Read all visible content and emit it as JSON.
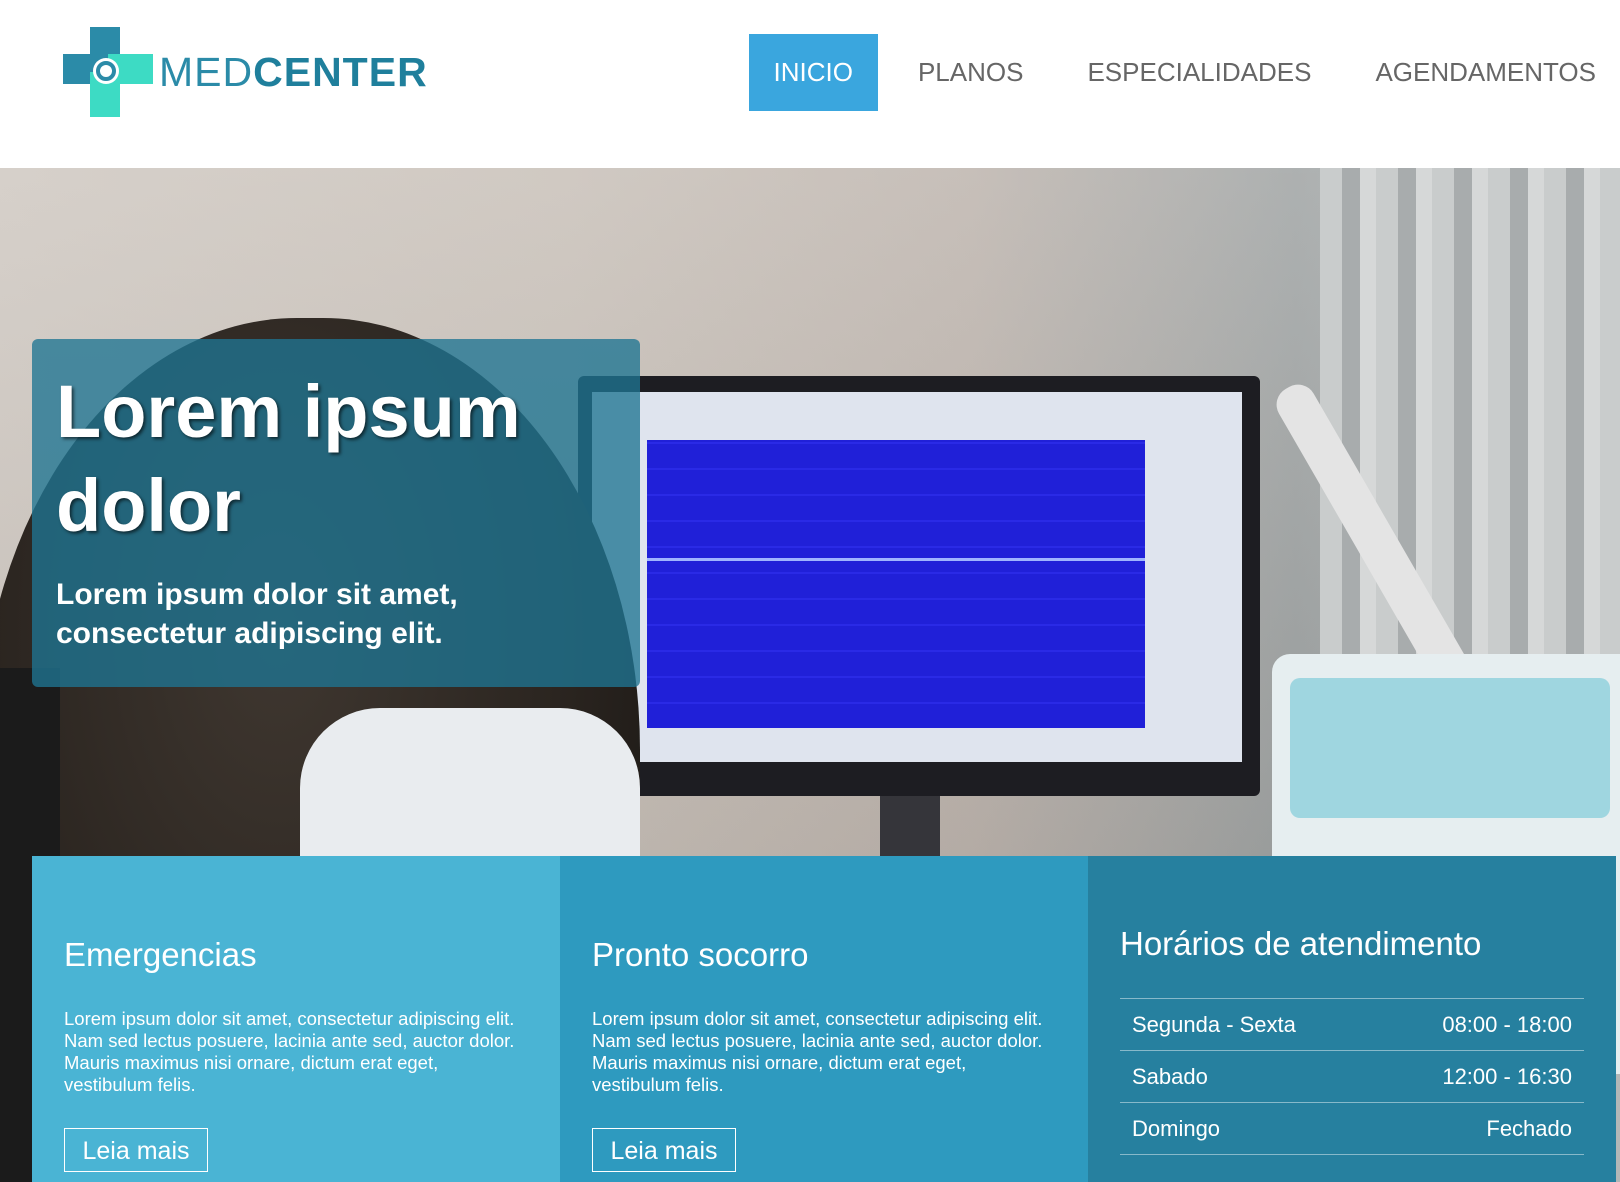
{
  "brand": {
    "logo_text_light": "MED",
    "logo_text_bold": "CENTER",
    "colors": {
      "primary": "#2b8ba8",
      "accent": "#3ddbc4",
      "nav_active": "#3aa6de"
    }
  },
  "nav": {
    "items": [
      {
        "label": "INICIO",
        "active": true
      },
      {
        "label": "PLANOS",
        "active": false
      },
      {
        "label": "ESPECIALIDADES",
        "active": false
      },
      {
        "label": "AGENDAMENTOS",
        "active": false
      }
    ]
  },
  "hero": {
    "title": "Lorem ipsum dolor",
    "subtitle": "Lorem ipsum dolor sit amet, consectetur adipiscing elit.",
    "image_description": "technician viewing a monitor with brain-wave readings beside a Nihon Kohden Neuropack device"
  },
  "features": [
    {
      "title": "Emergencias",
      "text": "Lorem ipsum dolor sit amet, consectetur adipiscing elit. Nam sed lectus posuere, lacinia ante sed, auctor dolor. Mauris maximus nisi ornare, dictum erat eget, vestibulum felis.",
      "button": "Leia mais",
      "color": "#4ab4d4"
    },
    {
      "title": "Pronto socorro",
      "text": "Lorem ipsum dolor sit amet, consectetur adipiscing elit. Nam sed lectus posuere, lacinia ante sed, auctor dolor. Mauris maximus nisi ornare, dictum erat eget, vestibulum felis.",
      "button": "Leia mais",
      "color": "#2e9abf"
    }
  ],
  "hours": {
    "title": "Horários de atendimento",
    "rows": [
      {
        "day": "Segunda - Sexta",
        "time": "08:00 - 18:00"
      },
      {
        "day": "Sabado",
        "time": "12:00 - 16:30"
      },
      {
        "day": "Domingo",
        "time": "Fechado"
      }
    ],
    "color": "#26809f"
  }
}
